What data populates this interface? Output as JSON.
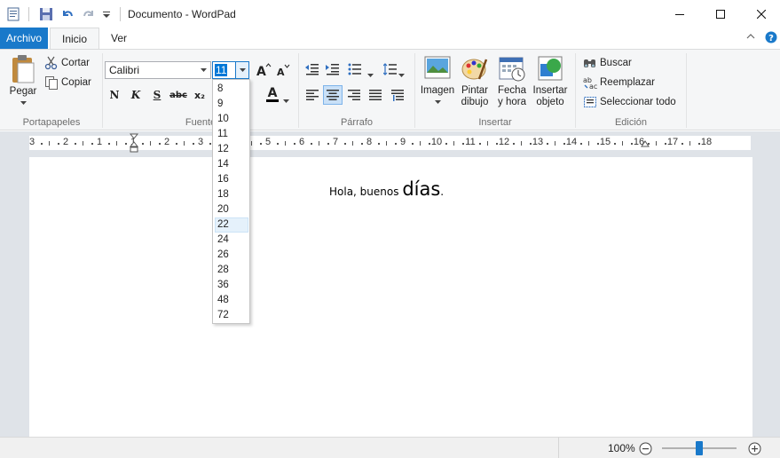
{
  "window": {
    "title": "Documento - WordPad",
    "minimize_label": "Minimizar",
    "maximize_label": "Maximizar",
    "close_label": "Cerrar"
  },
  "tabs": {
    "file": "Archivo",
    "home": "Inicio",
    "view": "Ver"
  },
  "clipboard": {
    "paste": "Pegar",
    "cut": "Cortar",
    "copy": "Copiar",
    "label": "Portapapeles"
  },
  "font": {
    "family": "Calibri",
    "size": "11",
    "label": "Fuente",
    "bold": "N",
    "italic": "K",
    "underline": "S",
    "strike": "abc",
    "subscript": "x₂",
    "color_letter": "A"
  },
  "paragraph": {
    "label": "Párrafo"
  },
  "insert": {
    "picture": "Imagen",
    "paint_1": "Pintar",
    "paint_2": "dibujo",
    "datetime_1": "Fecha",
    "datetime_2": "y hora",
    "object_1": "Insertar",
    "object_2": "objeto",
    "label": "Insertar"
  },
  "editing": {
    "find": "Buscar",
    "replace": "Reemplazar",
    "select_all": "Seleccionar todo",
    "label": "Edición"
  },
  "font_sizes": [
    "8",
    "9",
    "10",
    "11",
    "12",
    "14",
    "16",
    "18",
    "20",
    "22",
    "24",
    "26",
    "28",
    "36",
    "48",
    "72"
  ],
  "highlighted_size": "22",
  "ruler_numbers": [
    "3",
    "2",
    "1",
    "1",
    "2",
    "3",
    "4",
    "5",
    "6",
    "7",
    "8",
    "9",
    "10",
    "11",
    "12",
    "13",
    "14",
    "15",
    "16",
    "17",
    "18"
  ],
  "document": {
    "text_normal": "Hola, buenos ",
    "text_big": "días",
    "text_end": "."
  },
  "status": {
    "zoom": "100%"
  },
  "colors": {
    "accent": "#1979ca",
    "ribbon_bg": "#f5f6f7",
    "workspace": "#dfe3e8"
  }
}
